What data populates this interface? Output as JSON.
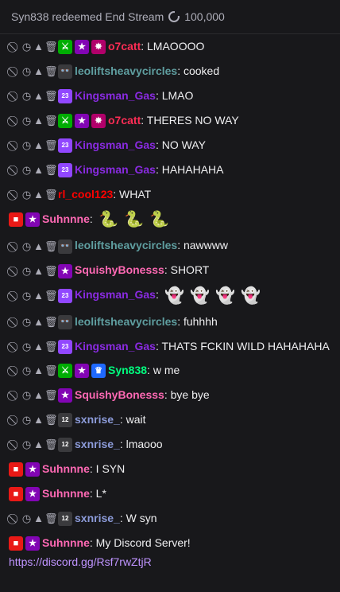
{
  "header": {
    "redeem_text": "Syn838 redeemed End Stream",
    "points": "100,000"
  },
  "colors": {
    "o7catt": "#ff2d55",
    "leolift": "#5f9ea0",
    "kingsman": "#8a2be2",
    "rlcool": "#ff0000",
    "suhnnne": "#ff69b4",
    "squishy": "#ff69b4",
    "syn": "#00ff7f",
    "sxnrise": "#8c9bd9"
  },
  "messages": [
    {
      "user": "o7catt",
      "text": ": LMAOOOO"
    },
    {
      "user": "leoliftsheavycircles",
      "text": ": cooked"
    },
    {
      "user": "Kingsman_Gas",
      "text": ": LMAO"
    },
    {
      "user": "o7catt",
      "text": ": THERES NO WAY"
    },
    {
      "user": "Kingsman_Gas",
      "text": ": NO WAY"
    },
    {
      "user": "Kingsman_Gas",
      "text": ": HAHAHAHA"
    },
    {
      "user": "rl_cool123",
      "text": ": WHAT"
    },
    {
      "user": "Suhnnne",
      "text": ":"
    },
    {
      "user": "leoliftsheavycircles",
      "text": ": nawwww"
    },
    {
      "user": "SquishyBonesss",
      "text": ": SHORT"
    },
    {
      "user": "Kingsman_Gas",
      "text": ":"
    },
    {
      "user": "leoliftsheavycircles",
      "text": ": fuhhhh"
    },
    {
      "user": "Kingsman_Gas",
      "text": ": THATS FCKIN WILD HAHAHAHA"
    },
    {
      "user": "Syn838",
      "text": ": w me"
    },
    {
      "user": "SquishyBonesss",
      "text": ": bye bye"
    },
    {
      "user": "sxnrise_",
      "text": ": wait"
    },
    {
      "user": "sxnrise_",
      "text": ": lmaooo"
    },
    {
      "user": "Suhnnne",
      "text": ": I SYN"
    },
    {
      "user": "Suhnnne",
      "text": ": L*"
    },
    {
      "user": "sxnrise_",
      "text": ": W syn"
    },
    {
      "user": "Suhnnne",
      "text": ": My Discord Server!"
    }
  ],
  "link": "https://discord.gg/Rsf7rwZtjR"
}
